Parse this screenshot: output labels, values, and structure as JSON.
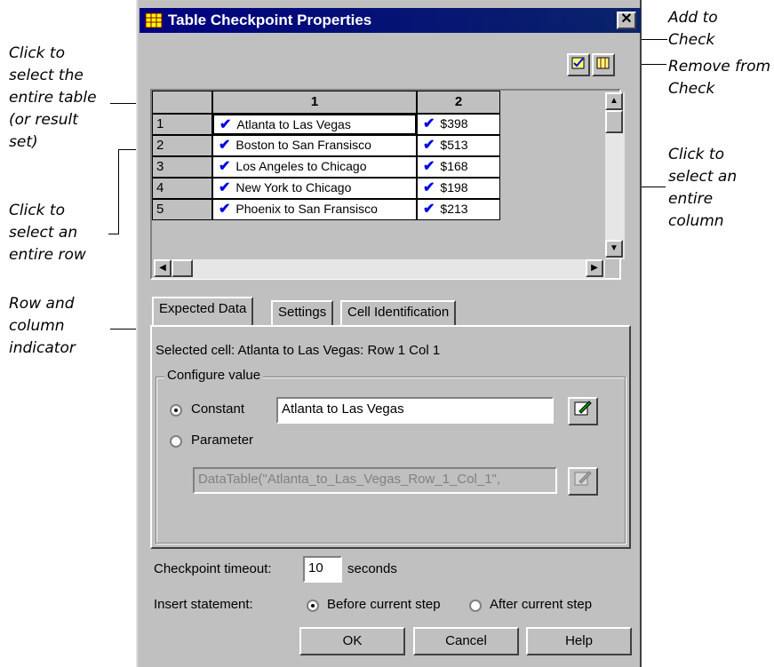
{
  "annotations": {
    "add_to_check": "Add to\nCheck",
    "remove_from_check": "Remove from\nCheck",
    "select_table": "Click to\nselect the\nentire table\n(or result\nset)",
    "select_row": "Click to\nselect an\nentire row",
    "select_column": "Click to\nselect an\nentire\ncolumn",
    "row_col_indicator": "Row and\ncolumn\nindicator"
  },
  "dialog": {
    "title": "Table Checkpoint Properties",
    "close_glyph": "✕"
  },
  "grid": {
    "columns": [
      "1",
      "2"
    ],
    "rows": [
      {
        "num": "1",
        "c1": "Atlanta to Las Vegas",
        "c2": "$398"
      },
      {
        "num": "2",
        "c1": "Boston to San Fransisco",
        "c2": "$513"
      },
      {
        "num": "3",
        "c1": "Los Angeles to Chicago",
        "c2": "$168"
      },
      {
        "num": "4",
        "c1": "New York to Chicago",
        "c2": "$198"
      },
      {
        "num": "5",
        "c1": "Phoenix to San Fransisco",
        "c2": "$213"
      }
    ],
    "check_glyph": "✔"
  },
  "tabs": [
    "Expected Data",
    "Settings",
    "Cell Identification"
  ],
  "expected": {
    "selected_cell": "Selected cell: Atlanta to Las Vegas: Row 1 Col 1",
    "group_label": "Configure value",
    "constant_label": "Constant",
    "constant_value": "Atlanta to Las Vegas",
    "parameter_label": "Parameter",
    "parameter_value": "DataTable(\"Atlanta_to_Las_Vegas_Row_1_Col_1\","
  },
  "footer": {
    "timeout_label": "Checkpoint timeout:",
    "timeout_value": "10",
    "timeout_unit": "seconds",
    "insert_label": "Insert statement:",
    "before_label": "Before current step",
    "after_label": "After current step",
    "ok": "OK",
    "cancel": "Cancel",
    "help": "Help"
  }
}
